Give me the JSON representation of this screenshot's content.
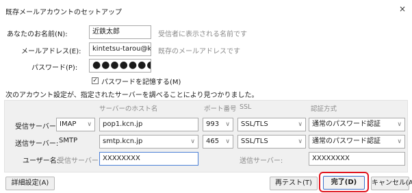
{
  "window": {
    "title": "既存メールアカウントのセットアップ",
    "close_glyph": "×"
  },
  "form": {
    "name_label": "あなたのお名前(N):",
    "name_value": "近鉄太郎",
    "name_hint": "受信者に表示される名前です",
    "email_label": "メールアドレス(E):",
    "email_value": "kintetsu-tarou@kcn.jp",
    "email_hint": "既存のメールアドレスです",
    "password_label": "パスワード(P):",
    "password_value": "●●●●●●●●",
    "remember_label": "パスワードを記憶する(M)",
    "remember_checked": true,
    "found_message": "次のアカウント設定が、指定されたサーバーを調べることにより見つかりました。"
  },
  "server_table": {
    "headers": {
      "hostname": "サーバーのホスト名",
      "port": "ポート番号",
      "ssl": "SSL",
      "auth": "認証方式"
    },
    "incoming": {
      "label": "受信サーバー:",
      "protocol": "IMAP",
      "hostname": "pop1.kcn.jp",
      "port": "993",
      "ssl": "SSL/TLS",
      "auth": "通常のパスワード認証"
    },
    "outgoing": {
      "label": "送信サーバー:",
      "protocol": "SMTP",
      "hostname": "smtp.kcn.jp",
      "port": "465",
      "ssl": "SSL/TLS",
      "auth": "通常のパスワード認証"
    },
    "username": {
      "label": "ユーザー名:",
      "incoming_label": "受信サーバー:",
      "incoming_value": "XXXXXXXX",
      "outgoing_label": "送信サーバー:",
      "outgoing_value": "XXXXXXXX"
    }
  },
  "buttons": {
    "advanced": "詳細設定(A)",
    "retest": "再テスト(T)",
    "done": "完了(D)",
    "cancel": "キャンセル(A)"
  },
  "colors": {
    "highlight": "#e0141e",
    "focus_border": "#4a7fd6",
    "panel_bg": "#f0f0f0"
  },
  "icons": {
    "dropdown": "chevron-down-icon",
    "close": "close-icon",
    "check": "check-icon"
  }
}
